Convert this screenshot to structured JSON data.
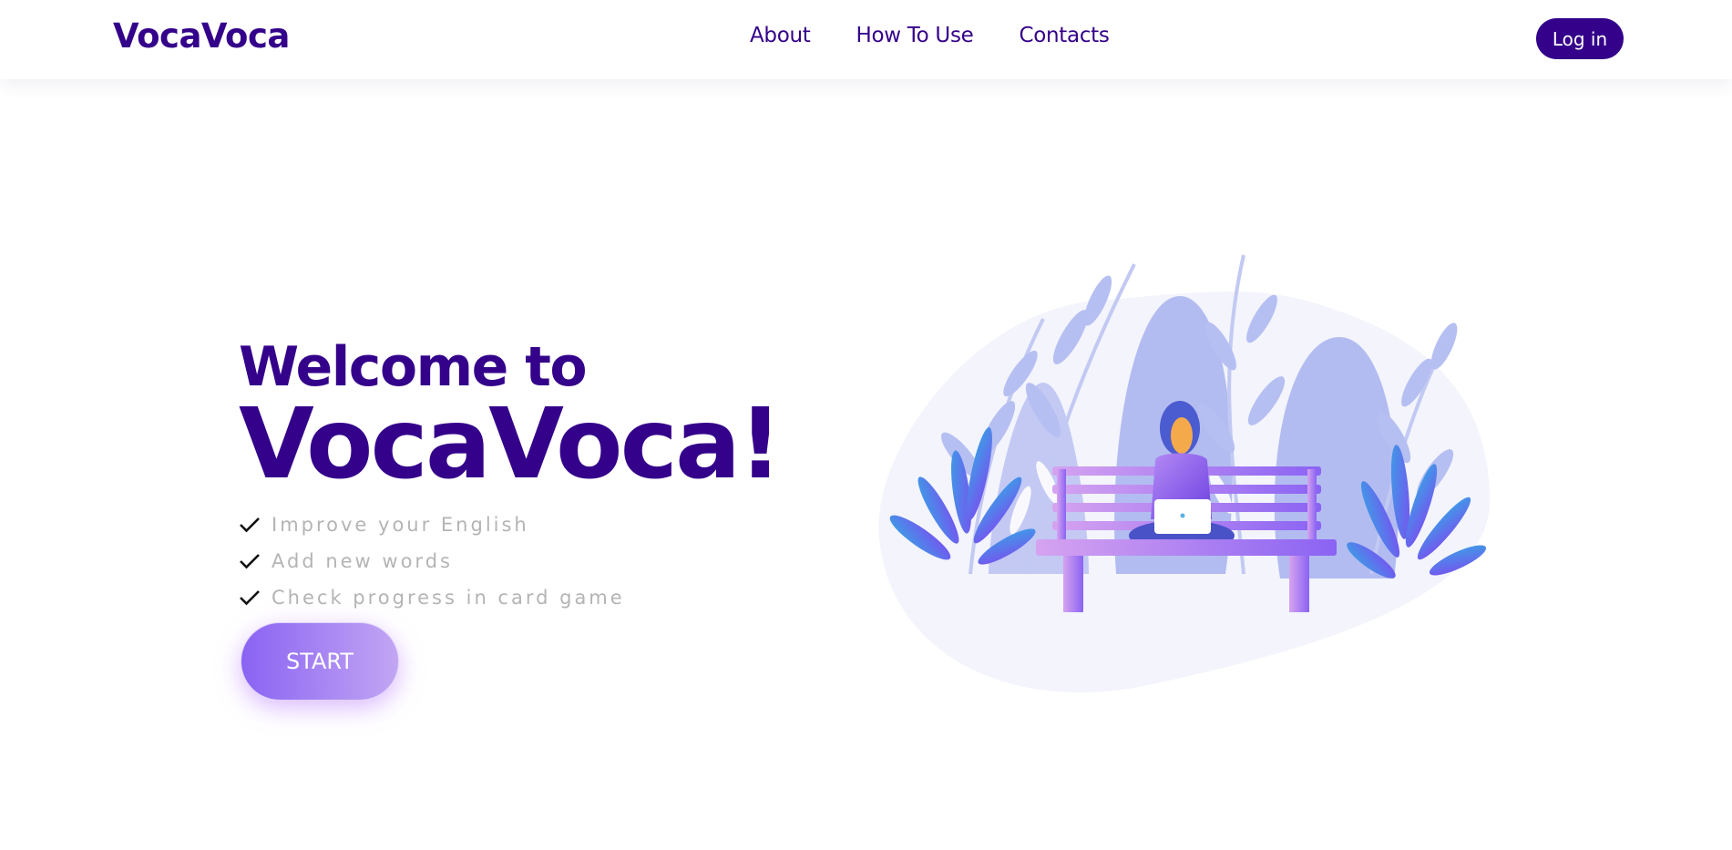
{
  "header": {
    "logo": "VocaVoca",
    "nav": [
      {
        "label": "About"
      },
      {
        "label": "How To Use"
      },
      {
        "label": "Contacts"
      }
    ],
    "login_label": "Log in"
  },
  "hero": {
    "welcome": "Welcome to",
    "brand": "VocaVoca!",
    "features": [
      "Improve your English",
      "Add new words",
      "Check progress in card game"
    ],
    "start_label": "START"
  },
  "colors": {
    "brand_primary": "#34028a",
    "feature_text": "#b4b4b4",
    "button_gradient_start": "#8a63f3",
    "button_gradient_end": "#c2a6f3"
  },
  "icons": {
    "feature_bullet": "check-icon",
    "illustration": "woman-on-bench-with-laptop-illustration"
  }
}
